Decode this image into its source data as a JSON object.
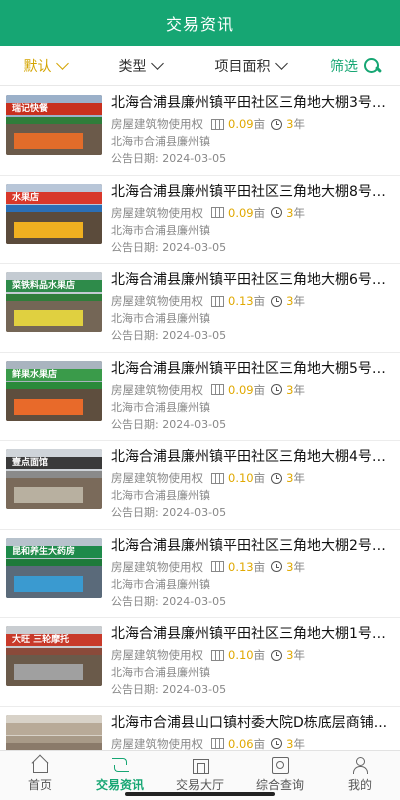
{
  "header": {
    "title": "交易资讯"
  },
  "filters": {
    "default": "默认",
    "type": "类型",
    "area": "项目面积",
    "filter": "筛选"
  },
  "colors": {
    "brand": "#16a673",
    "active_filter": "#d4a400",
    "value": "#e0a800"
  },
  "items": [
    {
      "title": "北海合浦县廉州镇平田社区三角地大棚3号门面...",
      "category": "房屋建筑物使用权",
      "area": "0.09",
      "area_unit": "亩",
      "years": "3",
      "years_unit": "年",
      "location": "北海市合浦县廉州镇",
      "date": "公告日期: 2024-03-05",
      "sign": "瑞记快餐",
      "thumb_colors": [
        "#9bb0c9",
        "#c8301e",
        "#2f7d3a",
        "#6b5a4a",
        "#e26c2a"
      ]
    },
    {
      "title": "北海合浦县廉州镇平田社区三角地大棚8号门面...",
      "category": "房屋建筑物使用权",
      "area": "0.09",
      "area_unit": "亩",
      "years": "3",
      "years_unit": "年",
      "location": "北海市合浦县廉州镇",
      "date": "公告日期: 2024-03-05",
      "sign": "水果店",
      "thumb_colors": [
        "#b8c6d8",
        "#d8382a",
        "#2b6fb5",
        "#5b4b3b",
        "#f0b020"
      ]
    },
    {
      "title": "北海合浦县廉州镇平田社区三角地大棚6号门面...",
      "category": "房屋建筑物使用权",
      "area": "0.13",
      "area_unit": "亩",
      "years": "3",
      "years_unit": "年",
      "location": "北海市合浦县廉州镇",
      "date": "公告日期: 2024-03-05",
      "sign": "菜铁料品水果店",
      "thumb_colors": [
        "#c4cbd2",
        "#2e8b4a",
        "#2f7d3a",
        "#746656",
        "#e0d040"
      ]
    },
    {
      "title": "北海合浦县廉州镇平田社区三角地大棚5号门面...",
      "category": "房屋建筑物使用权",
      "area": "0.09",
      "area_unit": "亩",
      "years": "3",
      "years_unit": "年",
      "location": "北海市合浦县廉州镇",
      "date": "公告日期: 2024-03-05",
      "sign": "鲜果水果店",
      "thumb_colors": [
        "#a9b4bf",
        "#3a9b4a",
        "#2a8a3a",
        "#5e4e3e",
        "#e86a2a"
      ]
    },
    {
      "title": "北海合浦县廉州镇平田社区三角地大棚4号门面...",
      "category": "房屋建筑物使用权",
      "area": "0.10",
      "area_unit": "亩",
      "years": "3",
      "years_unit": "年",
      "location": "北海市合浦县廉州镇",
      "date": "公告日期: 2024-03-05",
      "sign": "壹点面馆",
      "thumb_colors": [
        "#cfd4d9",
        "#3a3a3a",
        "#8a8a8a",
        "#7a6a5a",
        "#b8b0a0"
      ]
    },
    {
      "title": "北海合浦县廉州镇平田社区三角地大棚2号门面...",
      "category": "房屋建筑物使用权",
      "area": "0.13",
      "area_unit": "亩",
      "years": "3",
      "years_unit": "年",
      "location": "北海市合浦县廉州镇",
      "date": "公告日期: 2024-03-05",
      "sign": "昆和养生大药房",
      "thumb_colors": [
        "#b7c2cc",
        "#1e8a4a",
        "#1e7a3a",
        "#5a6a7a",
        "#3a9ad0"
      ]
    },
    {
      "title": "北海合浦县廉州镇平田社区三角地大棚1号门面...",
      "category": "房屋建筑物使用权",
      "area": "0.10",
      "area_unit": "亩",
      "years": "3",
      "years_unit": "年",
      "location": "北海市合浦县廉州镇",
      "date": "公告日期: 2024-03-05",
      "sign": "大旺 三轮摩托",
      "thumb_colors": [
        "#c9cdd1",
        "#c83a2a",
        "#8a4a3a",
        "#6a5a4a",
        "#a0a0a0"
      ]
    },
    {
      "title": "北海市合浦县山口镇村委大院D栋底层商铺...",
      "category": "房屋建筑物使用权",
      "area": "0.06",
      "area_unit": "亩",
      "years": "3",
      "years_unit": "年",
      "location": "",
      "date": "",
      "sign": "",
      "thumb_colors": [
        "#d8d2c8",
        "#b8aa98",
        "#a89a88",
        "#8a7a6a",
        "#c0b4a4"
      ]
    }
  ],
  "tabbar": {
    "tabs": [
      {
        "label": "首页",
        "icon": "home-icon"
      },
      {
        "label": "交易资讯",
        "icon": "trade-icon"
      },
      {
        "label": "交易大厅",
        "icon": "hall-icon"
      },
      {
        "label": "综合查询",
        "icon": "query-icon"
      },
      {
        "label": "我的",
        "icon": "me-icon"
      }
    ]
  }
}
